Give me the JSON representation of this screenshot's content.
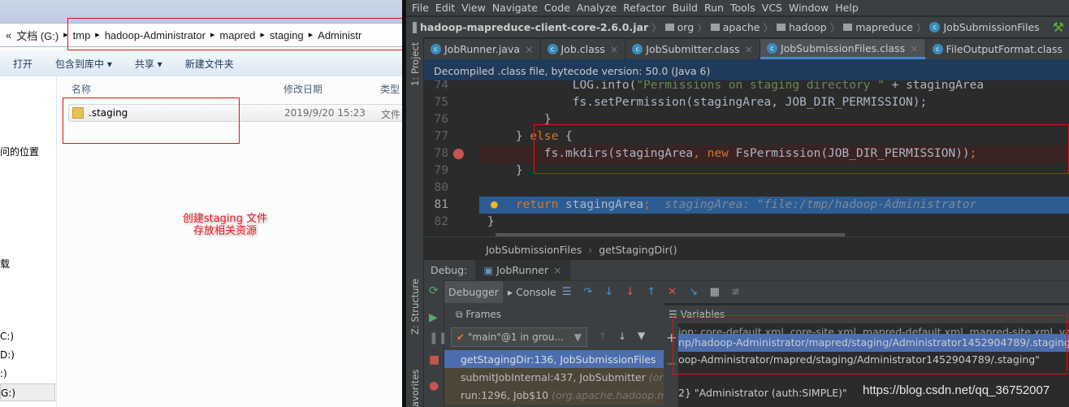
{
  "explorer": {
    "address": [
      "«",
      "文档 (G:)",
      "tmp",
      "hadoop-Administrator",
      "mapred",
      "staging",
      "Administr"
    ],
    "toolbar": [
      "打开",
      "包含到库中 ▾",
      "共享 ▾",
      "新建文件夹"
    ],
    "nav_items": [
      "问的位置",
      "载",
      "C:)",
      "D:)",
      ":)",
      "G:)"
    ],
    "columns": {
      "name": "名称",
      "date": "修改日期",
      "type": "类型"
    },
    "file": {
      "name": ".staging",
      "date": "2019/9/20 15:23",
      "type": "文件"
    },
    "annotation": [
      "创建staging 文件",
      "存放相关资源"
    ]
  },
  "ide": {
    "menu": [
      "File",
      "Edit",
      "View",
      "Navigate",
      "Code",
      "Analyze",
      "Refactor",
      "Build",
      "Run",
      "Tools",
      "VCS",
      "Window",
      "Help"
    ],
    "nav": [
      "hadoop-mapreduce-client-core-2.6.0.jar",
      "org",
      "apache",
      "hadoop",
      "mapreduce",
      "JobSubmissionFiles"
    ],
    "tabs": [
      {
        "label": "JobRunner.java"
      },
      {
        "label": "Job.class"
      },
      {
        "label": "JobSubmitter.class"
      },
      {
        "label": "JobSubmissionFiles.class",
        "active": true
      },
      {
        "label": "FileOutputFormat.class"
      }
    ],
    "left_tool": "1: Project",
    "banner": "Decompiled .class file, bytecode version: 50.0 (Java 6)",
    "code": [
      {
        "n": "74",
        "text": "            LOG.info(\"Permissions on staging directory \" + stagingArea"
      },
      {
        "n": "75",
        "text": "            fs.setPermission(stagingArea, JOB_DIR_PERMISSION);"
      },
      {
        "n": "76",
        "text": "        }"
      },
      {
        "n": "77",
        "text": "    } else {"
      },
      {
        "n": "78",
        "text": "        fs.mkdirs(stagingArea, new FsPermission(JOB_DIR_PERMISSION));"
      },
      {
        "n": "79",
        "text": "    }"
      },
      {
        "n": "80",
        "text": ""
      },
      {
        "n": "81",
        "text": "    return stagingArea;",
        "hint": "  stagingArea: \"file:/tmp/hadoop-Administrator"
      },
      {
        "n": "82",
        "text": "}"
      }
    ],
    "breadcrumb": [
      "JobSubmissionFiles",
      "getStagingDir()"
    ],
    "debug": {
      "label": "Debug:",
      "config": "JobRunner",
      "debugger_tab": "Debugger",
      "console_tab": "Console",
      "frames_title": "Frames",
      "variables_title": "Variables",
      "thread": "\"main\"@1 in grou...",
      "frames": [
        {
          "method": "getStagingDir:136, JobSubmissionFiles",
          "pkg": "(o"
        },
        {
          "method": "submitJobInternal:437, JobSubmitter",
          "pkg": "(org"
        },
        {
          "method": "run:1296, Job$10",
          "pkg": "(org.apache.hadoop.m"
        }
      ],
      "variables": [
        "ion: core-default.xml, core-site.xml, mapred-default.xml, mapred-site.xml, yarn-de",
        "np/hadoop-Administrator/mapred/staging/Administrator1452904789/.staging\"",
        "oop-Administrator/mapred/staging/Administrator1452904789/.staging\"",
        "",
        "2} \"Administrator (auth:SIMPLE)\""
      ],
      "side_tools": [
        "Z: Structure",
        "avorites"
      ]
    }
  },
  "watermark": "https://blog.csdn.net/qq_36752007",
  "colors": {
    "annotation_box": "#e21010",
    "selection": "#4b6eaf",
    "exec_line": "#2d5c93"
  }
}
